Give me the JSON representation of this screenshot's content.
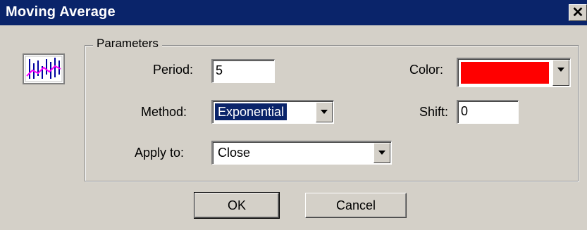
{
  "window": {
    "title": "Moving Average",
    "close_label": "✕"
  },
  "parameters": {
    "group_label": "Parameters",
    "period": {
      "label": "Period:",
      "value": "5"
    },
    "method": {
      "label": "Method:",
      "value": "Exponential"
    },
    "apply_to": {
      "label": "Apply to:",
      "value": "Close"
    },
    "color": {
      "label": "Color:",
      "value": "#ff0000"
    },
    "shift": {
      "label": "Shift:",
      "value": "0"
    }
  },
  "buttons": {
    "ok": "OK",
    "cancel": "Cancel"
  },
  "icons": {
    "indicator": "moving-average-chart-icon",
    "dropdown": "chevron-down-icon",
    "close": "close-icon"
  },
  "colors": {
    "titlebar": "#0a246a",
    "selection": "#0a246a",
    "dialog_bg": "#d4d0c8"
  }
}
